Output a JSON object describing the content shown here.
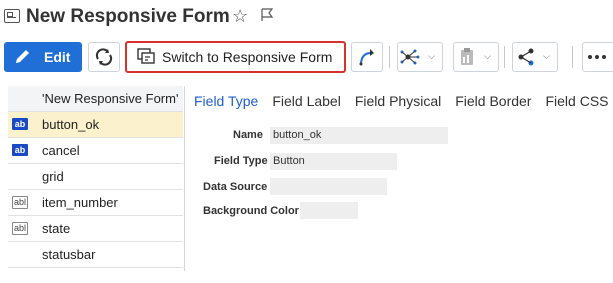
{
  "header": {
    "title": "New Responsive Form",
    "star_icon": "star-outline-icon",
    "flag_icon": "flag-outline-icon"
  },
  "toolbar": {
    "edit_label": "Edit",
    "switch_label": "Switch to Responsive Form",
    "accent_color": "#1f6fd6",
    "highlight_color": "#d9302d"
  },
  "list": {
    "header": "'New Responsive Form'",
    "items": [
      {
        "label": "button_ok",
        "badge": "ab",
        "selected": true
      },
      {
        "label": "cancel",
        "badge": "ab"
      },
      {
        "label": "grid",
        "badge": ""
      },
      {
        "label": "item_number",
        "badge": "abl"
      },
      {
        "label": "state",
        "badge": "abl"
      },
      {
        "label": "statusbar",
        "badge": ""
      }
    ]
  },
  "tabs": [
    "Field Type",
    "Field Label",
    "Field Physical",
    "Field Border",
    "Field CSS"
  ],
  "properties": {
    "name": {
      "label": "Name",
      "value": "button_ok"
    },
    "field_type": {
      "label": "Field Type",
      "value": "Button"
    },
    "data_source": {
      "label": "Data Source",
      "value": ""
    },
    "background_color": {
      "label": "Background Color",
      "value": ""
    }
  }
}
